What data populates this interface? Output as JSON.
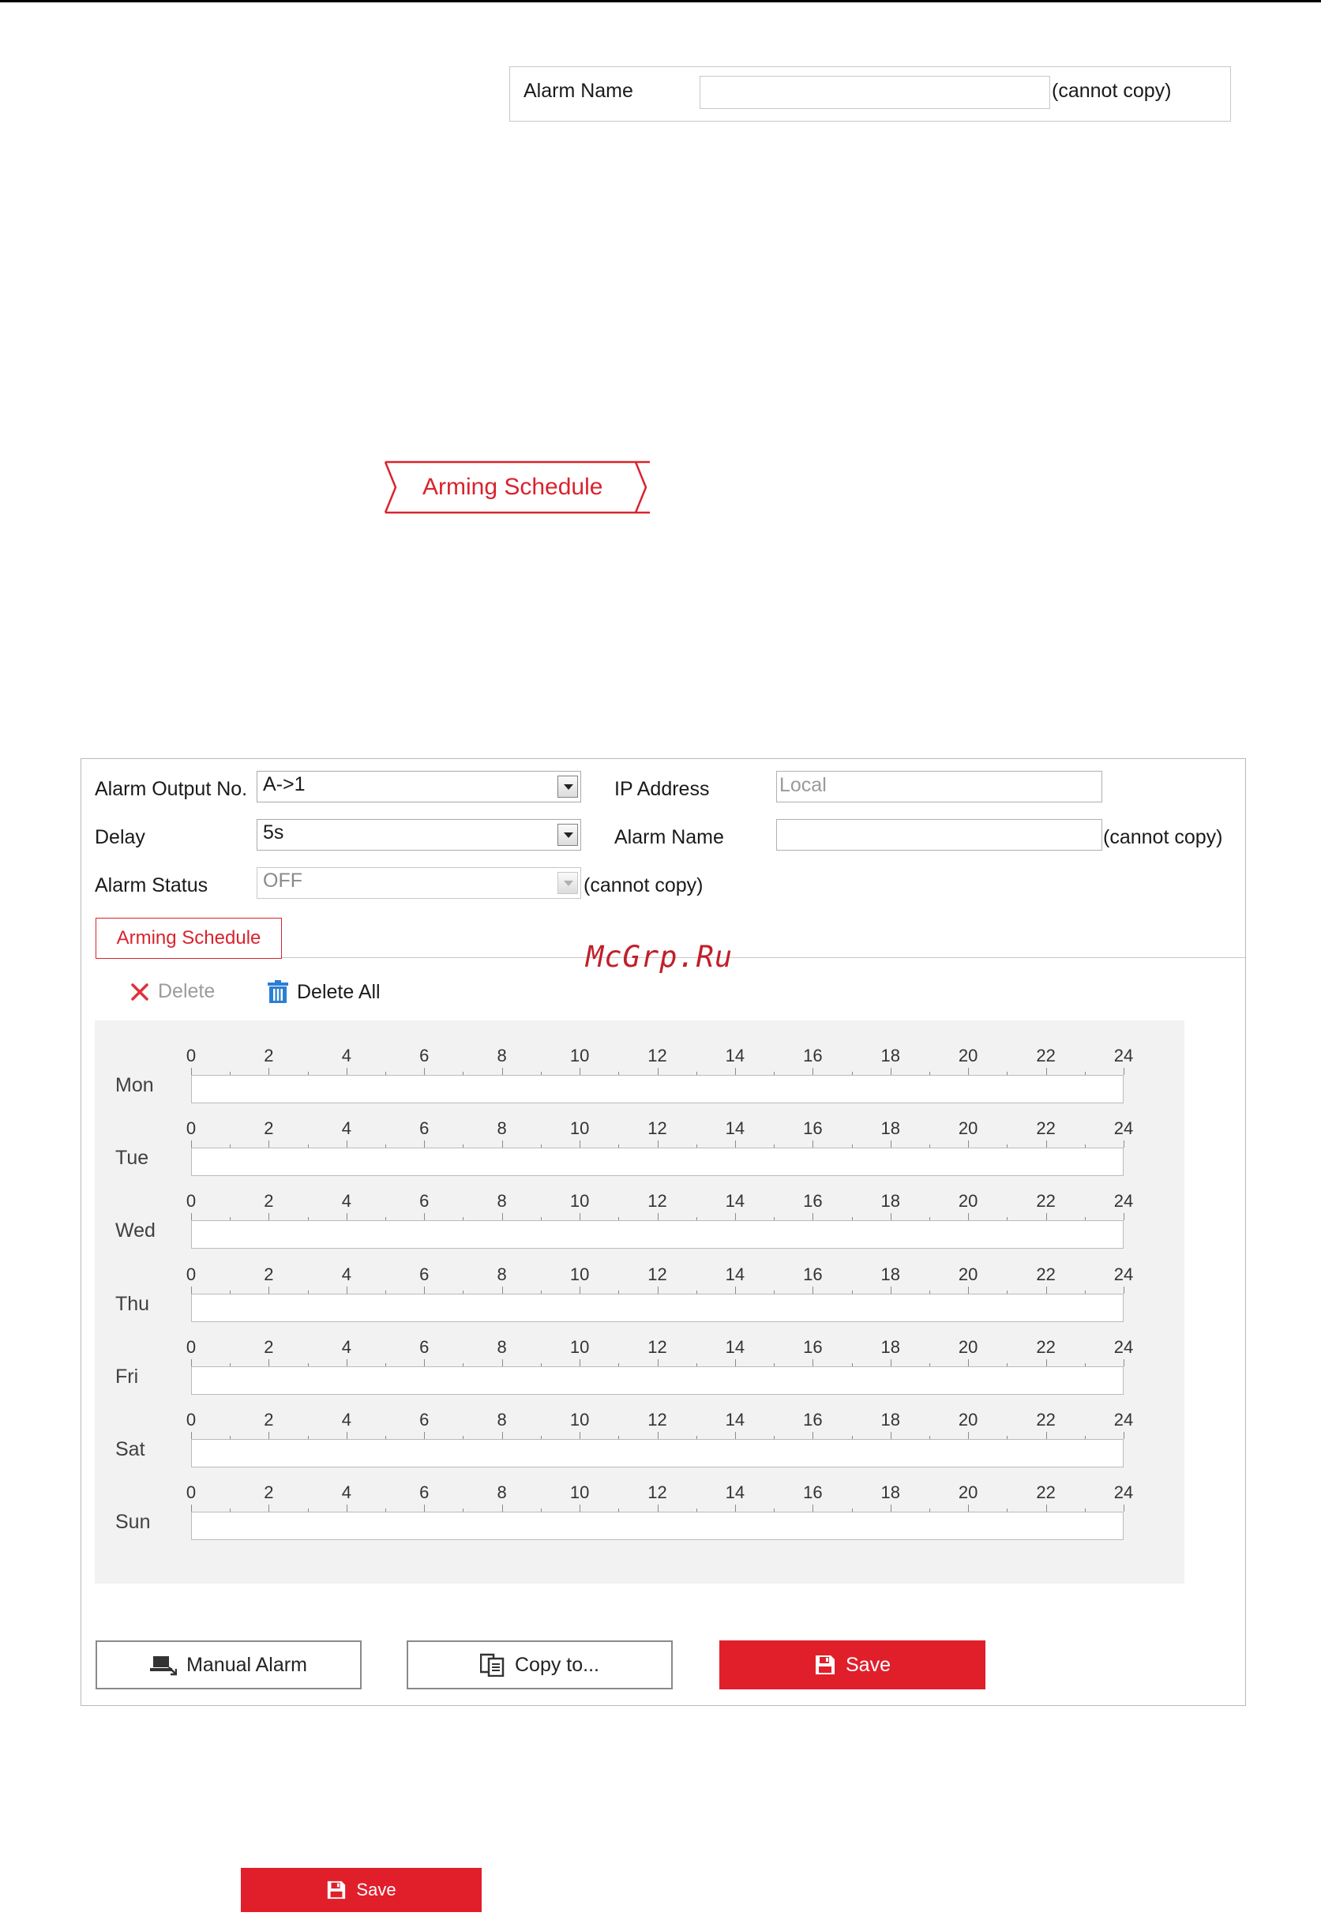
{
  "top_field": {
    "label": "Alarm Name",
    "value": "",
    "note": "(cannot copy)"
  },
  "arrow_tab": {
    "label": "Arming Schedule"
  },
  "panel": {
    "alarm_output_no": {
      "label": "Alarm Output No.",
      "value": "A->1"
    },
    "delay": {
      "label": "Delay",
      "value": "5s"
    },
    "alarm_status": {
      "label": "Alarm Status",
      "value": "OFF",
      "note": "(cannot copy)"
    },
    "ip_address": {
      "label": "IP Address",
      "placeholder": "Local"
    },
    "alarm_name": {
      "label": "Alarm Name",
      "value": "",
      "note": "(cannot copy)"
    },
    "tab": {
      "label": "Arming Schedule"
    },
    "watermark": "McGrp.Ru",
    "toolbar": {
      "delete_label": "Delete",
      "delete_all_label": "Delete All"
    },
    "schedule": {
      "days": [
        "Mon",
        "Tue",
        "Wed",
        "Thu",
        "Fri",
        "Sat",
        "Sun"
      ],
      "hour_labels": [
        "0",
        "2",
        "4",
        "6",
        "8",
        "10",
        "12",
        "14",
        "16",
        "18",
        "20",
        "22",
        "24"
      ]
    },
    "buttons": {
      "manual_alarm": "Manual Alarm",
      "copy_to": "Copy to...",
      "save": "Save"
    }
  },
  "bottom_save": {
    "label": "Save"
  },
  "colors": {
    "accent": "#e01f2b",
    "tab_red": "#d9232d",
    "schedule_bg": "#f2f2f2"
  },
  "icons": {
    "delete": "close-x-icon",
    "delete_all": "trash-icon",
    "manual_alarm": "laptop-alarm-icon",
    "copy_to": "copy-icon",
    "save": "floppy-disk-icon"
  }
}
